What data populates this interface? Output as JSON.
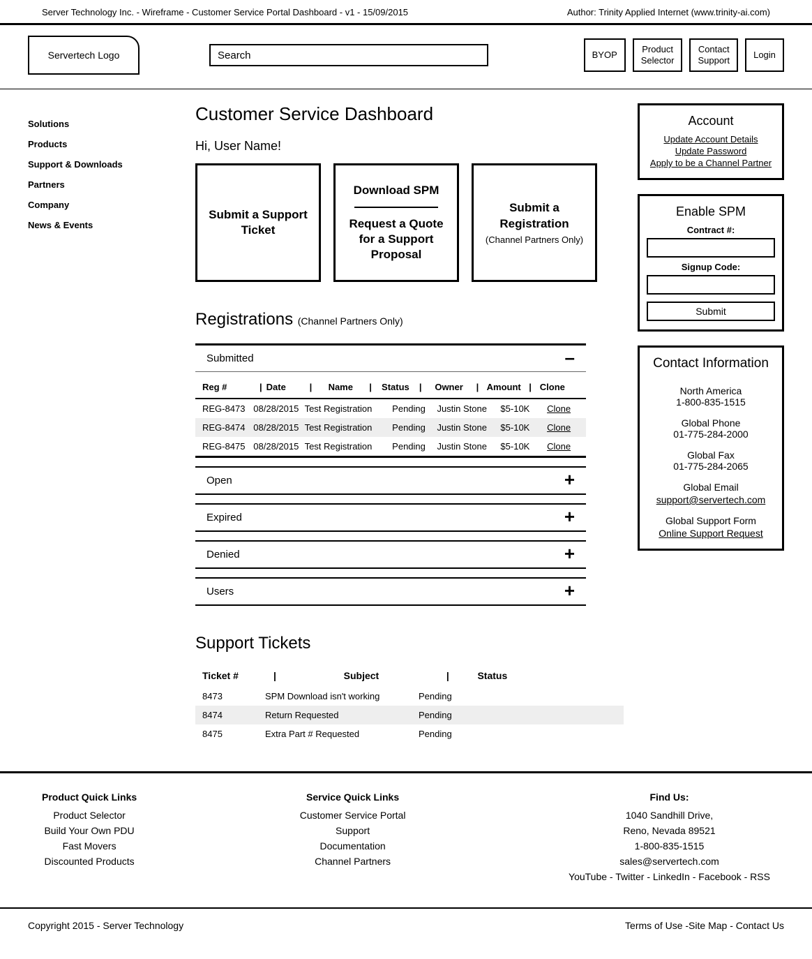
{
  "meta": {
    "left": "Server Technology Inc. - Wireframe - Customer Service Portal Dashboard - v1 - 15/09/2015",
    "right": "Author: Trinity Applied Internet (www.trinity-ai.com)"
  },
  "header": {
    "logo": "Servertech Logo",
    "search_placeholder": "Search",
    "buttons": {
      "byop": "BYOP",
      "product_selector": "Product\nSelector",
      "contact_support": "Contact\nSupport",
      "login": "Login"
    }
  },
  "sidebar": [
    "Solutions",
    "Products",
    "Support & Downloads",
    "Partners",
    "Company",
    "News & Events"
  ],
  "page_title": "Customer Service Dashboard",
  "greeting": "Hi, User Name!",
  "cards": {
    "submit_ticket": "Submit a Support Ticket",
    "download_spm": "Download SPM",
    "request_quote": "Request a Quote for a Support Proposal",
    "submit_reg": "Submit a Registration",
    "submit_reg_sub": "(Channel Partners Only)"
  },
  "account": {
    "title": "Account",
    "links": [
      "Update Account Details",
      "Update Password",
      "Apply to be a Channel Partner"
    ]
  },
  "enable_spm": {
    "title": "Enable SPM",
    "contract_label": "Contract #:",
    "code_label": "Signup Code:",
    "submit": "Submit"
  },
  "contact_info": {
    "title": "Contact Information",
    "items": [
      "North America",
      "1-800-835-1515",
      "Global Phone",
      "01-775-284-2000",
      "Global Fax",
      "01-775-284-2065",
      "Global Email",
      "support@servertech.com",
      "Global Support Form",
      "Online Support Request"
    ]
  },
  "registrations": {
    "title": "Registrations",
    "title_sub": "(Channel Partners Only)",
    "submitted": "Submitted",
    "headers": [
      "Reg #",
      "Date",
      "Name",
      "Status",
      "Owner",
      "Amount",
      "Clone"
    ],
    "rows": [
      {
        "reg": "REG-8473",
        "date": "08/28/2015",
        "name": "Test Registration",
        "status": "Pending",
        "owner": "Justin Stone",
        "amount": "$5-10K",
        "clone": "Clone"
      },
      {
        "reg": "REG-8474",
        "date": "08/28/2015",
        "name": "Test Registration",
        "status": "Pending",
        "owner": "Justin Stone",
        "amount": "$5-10K",
        "clone": "Clone"
      },
      {
        "reg": "REG-8475",
        "date": "08/28/2015",
        "name": "Test Registration",
        "status": "Pending",
        "owner": "Justin Stone",
        "amount": "$5-10K",
        "clone": "Clone"
      }
    ],
    "sections": [
      "Open",
      "Expired",
      "Denied",
      "Users"
    ]
  },
  "tickets": {
    "title": "Support Tickets",
    "headers": [
      "Ticket  #",
      "Subject",
      "Status"
    ],
    "rows": [
      {
        "id": "8473",
        "subject": "SPM Download isn't working",
        "status": "Pending"
      },
      {
        "id": "8474",
        "subject": "Return Requested",
        "status": "Pending"
      },
      {
        "id": "8475",
        "subject": "Extra Part # Requested",
        "status": "Pending"
      }
    ]
  },
  "footer": {
    "product_title": "Product Quick Links",
    "product_links": [
      "Product Selector",
      "Build Your Own PDU",
      "Fast Movers",
      "Discounted Products"
    ],
    "service_title": "Service Quick Links",
    "service_links": [
      "Customer Service Portal",
      "Support",
      "Documentation",
      "Channel Partners"
    ],
    "find_title": "Find Us:",
    "address": [
      "1040 Sandhill Drive,",
      "Reno, Nevada 89521",
      "1-800-835-1515",
      "sales@servertech.com"
    ],
    "social": "YouTube - Twitter - LinkedIn - Facebook - RSS"
  },
  "bottom": {
    "copyright": "Copyright 2015 - Server Technology",
    "links": "Terms of Use  -Site Map - Contact Us"
  }
}
